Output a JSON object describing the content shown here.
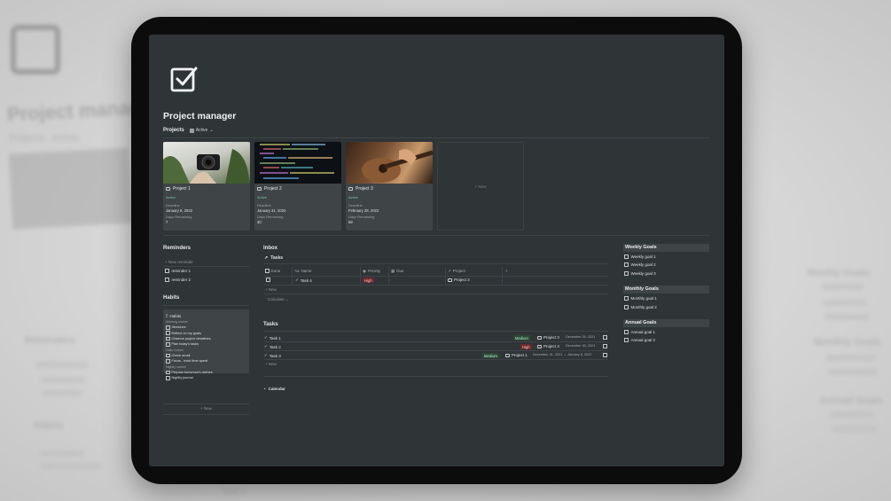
{
  "background": {
    "title": "Project manager",
    "projects_label": "Projects",
    "view": "Active",
    "reminders_title": "Reminders",
    "habits_title": "Habits",
    "weekly_goals_title": "Weekly Goals",
    "monthly_goals_title": "Monthly Goals",
    "annual_goals_title": "Annual Goals",
    "task": "Task 2"
  },
  "page": {
    "title": "Project manager",
    "icon": "checkbox-icon"
  },
  "projects": {
    "label": "Projects",
    "view_label": "Active",
    "new_label": "+ New",
    "cards": [
      {
        "name": "Project 1",
        "status": "Active",
        "deadline_label": "Deadline",
        "deadline": "January 8, 2022",
        "days_label": "Days Remaining",
        "days": "7"
      },
      {
        "name": "Project 2",
        "status": "Active",
        "deadline_label": "Deadline",
        "deadline": "January 31, 2022",
        "days_label": "Days Remaining",
        "days": "30"
      },
      {
        "name": "Project 3",
        "status": "Active",
        "deadline_label": "Deadline",
        "deadline": "February 28, 2022",
        "days_label": "Days Remaining",
        "days": "58"
      }
    ]
  },
  "reminders": {
    "title": "Reminders",
    "new_label": "+ New reminder",
    "items": [
      "reminder 1",
      "reminder 2"
    ]
  },
  "habits": {
    "title": "Habits",
    "card_title": "Habits",
    "new_label": "+ New",
    "morning_label": "Morning routine",
    "morning": [
      "Stretches",
      "Reflect on my goals",
      "Observe project deadlines",
      "Plan today's tasks"
    ],
    "daily_label": "Daily routine",
    "daily": [
      "Check email",
      "Focus - track time spent"
    ],
    "nightly_label": "Nightly routine",
    "nightly": [
      "Prepare tomorrow's clothes",
      "Nightly journal"
    ]
  },
  "inbox": {
    "title": "Inbox",
    "view_label": "Tasks",
    "columns": {
      "done": "Done",
      "name": "Name",
      "priority": "Priority",
      "due": "Due",
      "project": "Project",
      "add": "+"
    },
    "row": {
      "name": "Task 4",
      "priority": "High",
      "project": "Project 2"
    },
    "new_label": "+ New",
    "calculate_label": "Calculate ⌄"
  },
  "tasks": {
    "title": "Tasks",
    "new_label": "+ New",
    "items": [
      {
        "name": "Task 1",
        "priority": "Medium",
        "project": "Project 3",
        "date": "December 29, 2021"
      },
      {
        "name": "Task 2",
        "priority": "High",
        "project": "Project 3",
        "date": "December 30, 2021"
      },
      {
        "name": "Task 3",
        "priority": "Medium",
        "project": "Project 1",
        "date": "December 31, 2021 → January 6, 2022"
      }
    ]
  },
  "calendar": {
    "label": "Calendar"
  },
  "goals": {
    "weekly_title": "Weekly Goals",
    "weekly": [
      "Weekly goal 1",
      "Weekly goal 2",
      "Weekly goal 3"
    ],
    "monthly_title": "Monthly Goals",
    "monthly": [
      "Monthly goal 1",
      "Monthly goal 2"
    ],
    "annual_title": "Annual Goals",
    "annual": [
      "Annual goal 1",
      "Annual goal 2"
    ]
  },
  "colors": {
    "screen_bg": "#2f3437",
    "card_bg": "#3f4447",
    "high": "#6b2a2a",
    "medium": "#2b4a37",
    "active": "#7ec89a"
  }
}
